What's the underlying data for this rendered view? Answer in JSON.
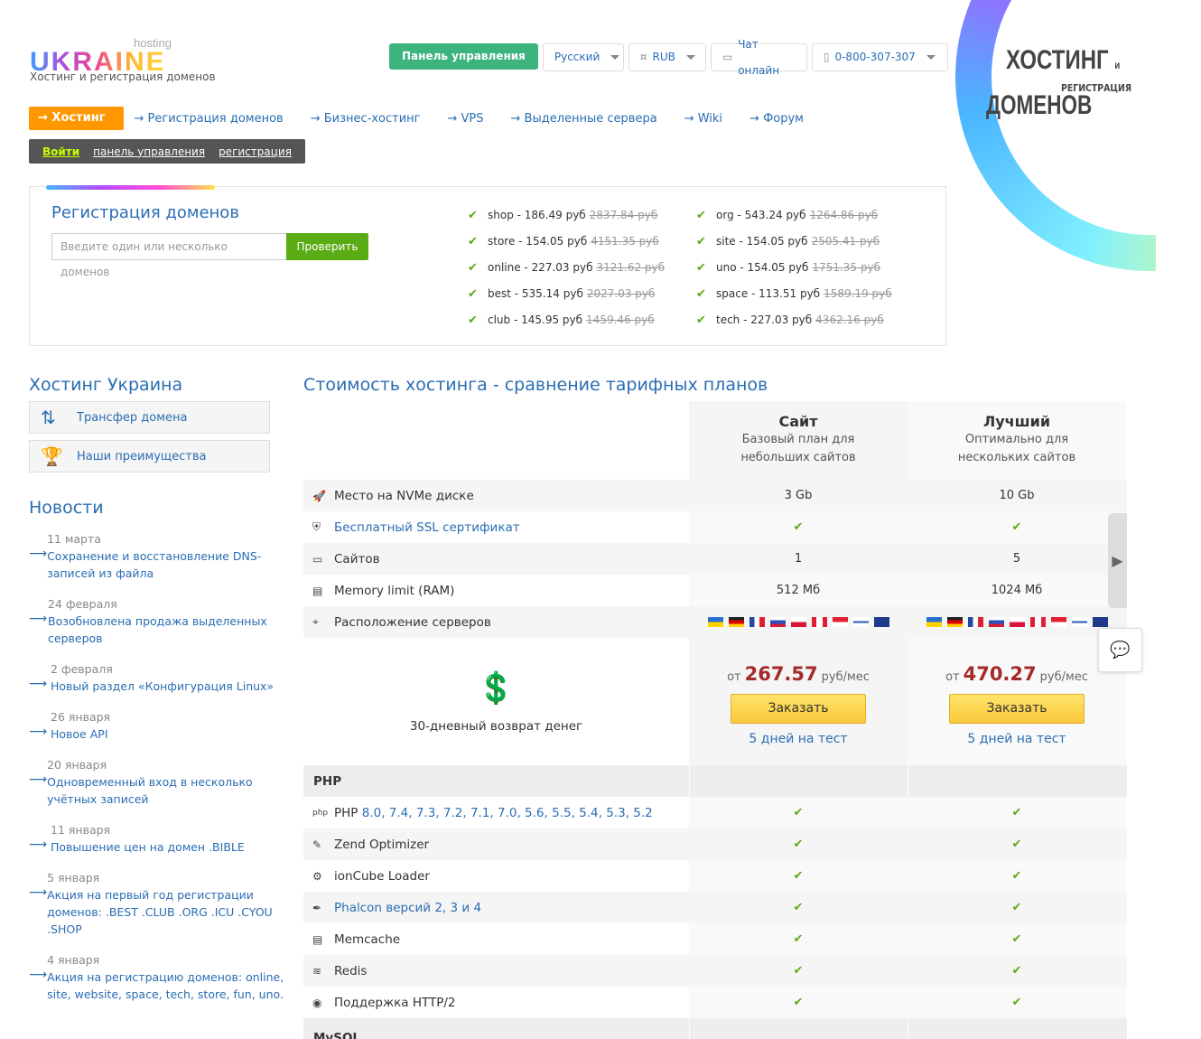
{
  "logo": {
    "hosting": "hosting",
    "name": "UKRAINE",
    "subtitle": "Хостинг и регистрация доменов"
  },
  "topbar": {
    "panel": "Панель управления",
    "language": "Русский",
    "currency": "RUB",
    "chat": "Чат онлайн",
    "phone": "0-800-307-307"
  },
  "promo": {
    "line1": "ХОСТИНГ",
    "and": "и",
    "line2": "РЕГИСТРАЦИЯ",
    "line3": "ДОМЕНОВ"
  },
  "nav": {
    "active": "→ Хостинг",
    "items": [
      "→ Регистрация доменов",
      "→ Бизнес-хостинг",
      "→ VPS",
      "→ Выделенные сервера",
      "→ Wiki",
      "→ Форум"
    ]
  },
  "login": {
    "login": "Войти",
    "panel": "панель управления",
    "register": "регистрация"
  },
  "domains": {
    "title": "Регистрация доменов",
    "placeholder": "Введите один или несколько доменов",
    "check": "Проверить",
    "list": [
      {
        "price": "shop - 186.49 руб",
        "old": "2837.84 руб"
      },
      {
        "price": "org - 543.24 руб",
        "old": "1264.86 руб"
      },
      {
        "price": "store - 154.05 руб",
        "old": "4151.35 руб"
      },
      {
        "price": "site - 154.05 руб",
        "old": "2505.41 руб"
      },
      {
        "price": "online - 227.03 руб",
        "old": "3121.62 руб"
      },
      {
        "price": "uno - 154.05 руб",
        "old": "1751.35 руб"
      },
      {
        "price": "best - 535.14 руб",
        "old": "2027.03 руб"
      },
      {
        "price": "space - 113.51 руб",
        "old": "1589.19 руб"
      },
      {
        "price": "club - 145.95 руб",
        "old": "1459.46 руб"
      },
      {
        "price": "tech - 227.03 руб",
        "old": "4362.16 руб"
      }
    ]
  },
  "sidebar": {
    "title": "Хостинг Украина",
    "transfer": "Трансфер домена",
    "advantages": "Наши преимущества",
    "news_title": "Новости",
    "news": [
      {
        "date": "11 марта",
        "text": "Сохранение и восстановление DNS-записей из файла"
      },
      {
        "date": "24 февраля",
        "text": "Возобновлена продажа выделенных серверов"
      },
      {
        "date": "2 февраля",
        "text": "Новый раздел «Конфигурация Linux»"
      },
      {
        "date": "26 января",
        "text": "Новое API"
      },
      {
        "date": "20 января",
        "text": "Одновременный вход в несколько учётных записей"
      },
      {
        "date": "11 января",
        "text": "Повышение цен на домен .BIBLE"
      },
      {
        "date": "5 января",
        "text": "Акция на первый год регистрации доменов: .BEST .CLUB .ORG .ICU .CYOU .SHOP"
      },
      {
        "date": "4 января",
        "text": "Акция на регистрацию доменов: online, site, website, space, tech, store, fun, uno."
      }
    ]
  },
  "table": {
    "title": "Стоимость хостинга - сравнение тарифных планов",
    "plans": [
      {
        "name": "Сайт",
        "desc1": "Базовый план для",
        "desc2": "небольших сайтов",
        "price": "267.57",
        "from": "от",
        "unit": "руб/мес",
        "order": "Заказать",
        "test": "5 дней на тест"
      },
      {
        "name": "Лучший",
        "desc1": "Оптимально для",
        "desc2": "нескольких сайтов",
        "price": "470.27",
        "from": "от",
        "unit": "руб/мес",
        "order": "Заказать",
        "test": "5 дней на тест"
      }
    ],
    "rows": {
      "disk": {
        "label": "Место на NVMe диске",
        "v1": "3 Gb",
        "v2": "10 Gb"
      },
      "ssl": {
        "label": "Бесплатный SSL сертификат"
      },
      "sites": {
        "label": "Сайтов",
        "v1": "1",
        "v2": "5"
      },
      "ram": {
        "label": "Memory limit (RAM)",
        "v1": "512 Мб",
        "v2": "1024 Мб"
      },
      "location": {
        "label": "Расположение серверов"
      }
    },
    "refund": "30-дневный возврат денег",
    "php_section": "PHP",
    "php_label": "PHP",
    "php_versions": "8.0, 7.4, 7.3, 7.2, 7.1, 7.0, 5.6, 5.5, 5.4, 5.3, 5.2",
    "php_rows": {
      "zend": "Zend Optimizer",
      "ioncube": "ionCube Loader",
      "phalcon": "Phalcon версий 2, 3 и 4",
      "memcache": "Memcache",
      "redis": "Redis",
      "http2": "Поддержка HTTP/2"
    },
    "mysql_section": "MySQL"
  },
  "colors": {
    "accent": "#ff9800",
    "link": "#2a6db3",
    "green": "#5bab15",
    "price": "#a52a2a",
    "panel_btn": "#3db37e"
  }
}
